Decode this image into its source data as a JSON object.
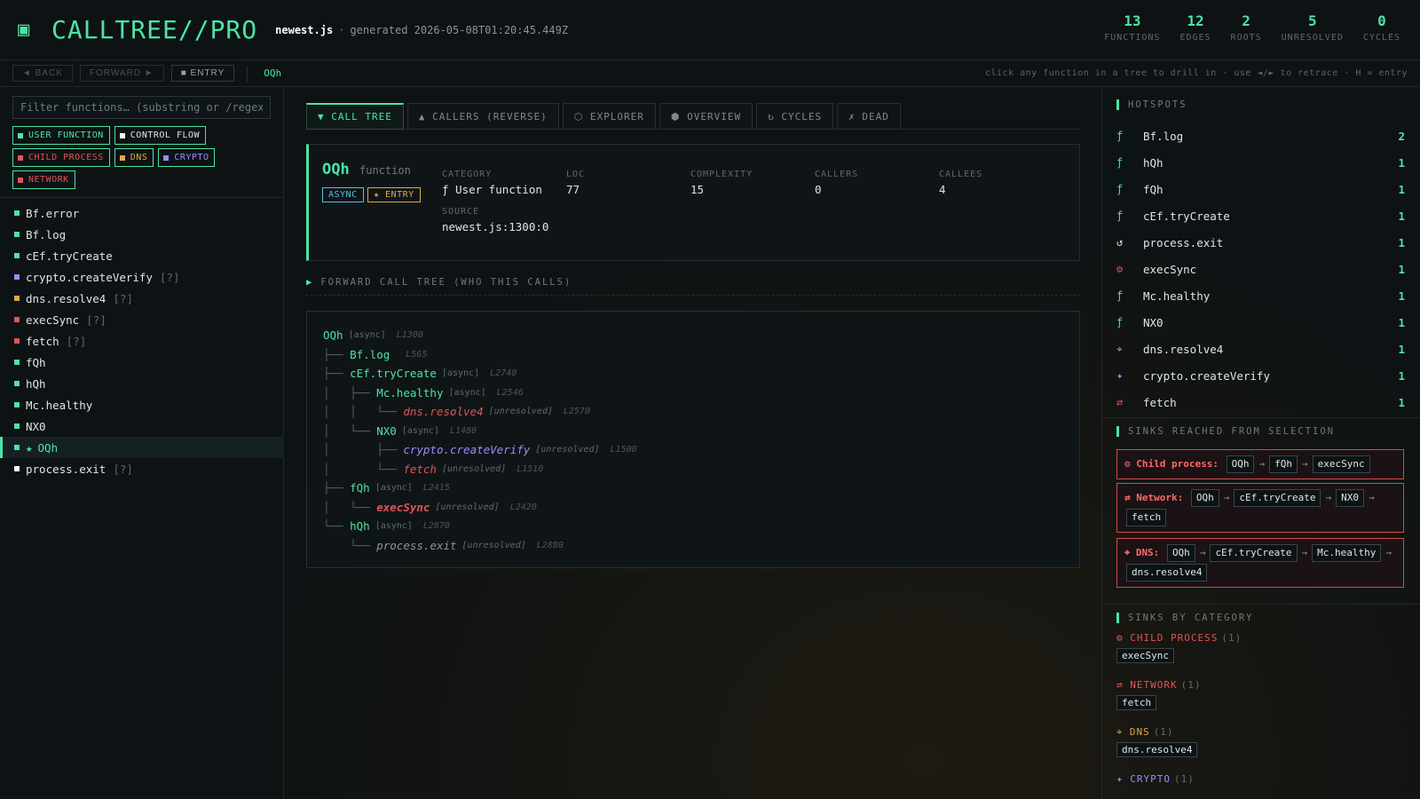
{
  "header": {
    "logo_icon": "▣",
    "title": "CALLTREE//PRO",
    "file": "newest.js",
    "separator": "·",
    "generated": "generated 2026-05-08T01:20:45.449Z",
    "stats": [
      {
        "value": "13",
        "label": "FUNCTIONS"
      },
      {
        "value": "12",
        "label": "EDGES"
      },
      {
        "value": "2",
        "label": "ROOTS"
      },
      {
        "value": "5",
        "label": "UNRESOLVED"
      },
      {
        "value": "0",
        "label": "CYCLES"
      }
    ]
  },
  "nav": {
    "back": "◄ BACK",
    "forward": "FORWARD ►",
    "entry": "■ ENTRY",
    "current": "OQh",
    "hint": "click any function in a tree to drill in · use ◄/► to retrace · H = entry"
  },
  "left": {
    "filter_placeholder": "Filter functions… (substring or /regex/)",
    "chips": [
      {
        "label": "USER FUNCTION",
        "color": "#4ee3a3"
      },
      {
        "label": "CONTROL FLOW",
        "color": "#ffffff"
      },
      {
        "label": "CHILD PROCESS",
        "color": "#e05555"
      },
      {
        "label": "DNS",
        "color": "#e0a64a"
      },
      {
        "label": "CRYPTO",
        "color": "#9a8cff"
      },
      {
        "label": "NETWORK",
        "color": "#e05555"
      }
    ],
    "functions": [
      {
        "name": "Bf.error",
        "suffix": "",
        "color": "#4ee3a3"
      },
      {
        "name": "Bf.log",
        "suffix": "",
        "color": "#4ee3a3"
      },
      {
        "name": "cEf.tryCreate",
        "suffix": "",
        "color": "#4ee3a3"
      },
      {
        "name": "crypto.createVerify",
        "suffix": "[?]",
        "color": "#9a8cff"
      },
      {
        "name": "dns.resolve4",
        "suffix": "[?]",
        "color": "#e0a64a"
      },
      {
        "name": "execSync",
        "suffix": "[?]",
        "color": "#e05555"
      },
      {
        "name": "fetch",
        "suffix": "[?]",
        "color": "#e05555"
      },
      {
        "name": "fQh",
        "suffix": "",
        "color": "#4ee3a3"
      },
      {
        "name": "hQh",
        "suffix": "",
        "color": "#4ee3a3"
      },
      {
        "name": "Mc.healthy",
        "suffix": "",
        "color": "#4ee3a3"
      },
      {
        "name": "NX0",
        "suffix": "",
        "color": "#4ee3a3"
      },
      {
        "name": "OQh",
        "suffix": "",
        "color": "#4ee3a3",
        "star": "★"
      },
      {
        "name": "process.exit",
        "suffix": "[?]",
        "color": "#ffffff"
      }
    ]
  },
  "tabs": [
    {
      "label": "▼ CALL TREE"
    },
    {
      "label": "▲ CALLERS (REVERSE)"
    },
    {
      "label": "⬡ EXPLORER"
    },
    {
      "label": "⬢ OVERVIEW"
    },
    {
      "label": "↻ CYCLES"
    },
    {
      "label": "✗ DEAD"
    }
  ],
  "card": {
    "name": "OQh",
    "kind": "function",
    "badge_async": "ASYNC",
    "badge_entry": "★ ENTRY",
    "category_label": "CATEGORY",
    "category_value": "ƒ User function",
    "loc_label": "LOC",
    "loc_value": "77",
    "complexity_label": "COMPLEXITY",
    "complexity_value": "15",
    "callers_label": "CALLERS",
    "callers_value": "0",
    "callees_label": "CALLEES",
    "callees_value": "4",
    "source_label": "SOURCE",
    "source_value": "newest.js:1300:0"
  },
  "section": {
    "icon": "▶",
    "title": "FORWARD CALL TREE (WHO THIS CALLS)"
  },
  "tree": [
    {
      "prefix": "",
      "name": "OQh",
      "tag": "[async]",
      "line": "L1300",
      "kind": "user"
    },
    {
      "prefix": "├── ",
      "name": "Bf.log",
      "tag": "",
      "line": "L565",
      "kind": "user"
    },
    {
      "prefix": "├── ",
      "name": "cEf.tryCreate",
      "tag": "[async]",
      "line": "L2740",
      "kind": "user"
    },
    {
      "prefix": "│   ├── ",
      "name": "Mc.healthy",
      "tag": "[async]",
      "line": "L2546",
      "kind": "user"
    },
    {
      "prefix": "│   │   └── ",
      "name": "dns.resolve4",
      "tag": "[unresolved]",
      "line": "L2570",
      "kind": "dns"
    },
    {
      "prefix": "│   └── ",
      "name": "NX0",
      "tag": "[async]",
      "line": "L1480",
      "kind": "user"
    },
    {
      "prefix": "│       ├── ",
      "name": "crypto.createVerify",
      "tag": "[unresolved]",
      "line": "L1500",
      "kind": "crypto"
    },
    {
      "prefix": "│       └── ",
      "name": "fetch",
      "tag": "[unresolved]",
      "line": "L1510",
      "kind": "fetch"
    },
    {
      "prefix": "├── ",
      "name": "fQh",
      "tag": "[async]",
      "line": "L2415",
      "kind": "user"
    },
    {
      "prefix": "│   └── ",
      "name": "execSync",
      "tag": "[unresolved]",
      "line": "L2420",
      "kind": "exec"
    },
    {
      "prefix": "└── ",
      "name": "hQh",
      "tag": "[async]",
      "line": "L2870",
      "kind": "user"
    },
    {
      "prefix": "    └── ",
      "name": "process.exit",
      "tag": "[unresolved]",
      "line": "L2880",
      "kind": "exit"
    }
  ],
  "right": {
    "hotspots_title": "HOTSPOTS",
    "hotspots": [
      {
        "icon": "ƒ",
        "name": "Bf.log",
        "count": "2",
        "color": "#4ee3a3"
      },
      {
        "icon": "ƒ",
        "name": "hQh",
        "count": "1",
        "color": "#4ee3a3"
      },
      {
        "icon": "ƒ",
        "name": "fQh",
        "count": "1",
        "color": "#4ee3a3"
      },
      {
        "icon": "ƒ",
        "name": "cEf.tryCreate",
        "count": "1",
        "color": "#4ee3a3"
      },
      {
        "icon": "↺",
        "name": "process.exit",
        "count": "1",
        "color": "#dfe6e7"
      },
      {
        "icon": "⚙",
        "name": "execSync",
        "count": "1",
        "color": "#e05555"
      },
      {
        "icon": "ƒ",
        "name": "Mc.healthy",
        "count": "1",
        "color": "#4ee3a3"
      },
      {
        "icon": "ƒ",
        "name": "NX0",
        "count": "1",
        "color": "#4ee3a3"
      },
      {
        "icon": "⌖",
        "name": "dns.resolve4",
        "count": "1",
        "color": "#e0a64a"
      },
      {
        "icon": "✦",
        "name": "crypto.createVerify",
        "count": "1",
        "color": "#9a8cff"
      },
      {
        "icon": "⇄",
        "name": "fetch",
        "count": "1",
        "color": "#e05555"
      }
    ],
    "sinks_title": "SINKS REACHED FROM SELECTION",
    "sinks": [
      {
        "label": "⚙ Child process:",
        "path": [
          "OQh",
          "fQh",
          "execSync"
        ]
      },
      {
        "label": "⇄ Network:",
        "path": [
          "OQh",
          "cEf.tryCreate",
          "NX0",
          "fetch"
        ]
      },
      {
        "label": "⌖ DNS:",
        "path": [
          "OQh",
          "cEf.tryCreate",
          "Mc.healthy",
          "dns.resolve4"
        ]
      }
    ],
    "arrow": "→",
    "category_title": "SINKS BY CATEGORY",
    "categories": [
      {
        "label": "⚙ CHILD PROCESS",
        "count": "(1)",
        "item": "execSync",
        "color": "#e05555"
      },
      {
        "label": "⇄ NETWORK",
        "count": "(1)",
        "item": "fetch",
        "color": "#e05555"
      },
      {
        "label": "⌖ DNS",
        "count": "(1)",
        "item": "dns.resolve4",
        "color": "#e0a64a"
      },
      {
        "label": "✦ CRYPTO",
        "count": "(1)",
        "item": "",
        "color": "#9a8cff"
      }
    ]
  }
}
